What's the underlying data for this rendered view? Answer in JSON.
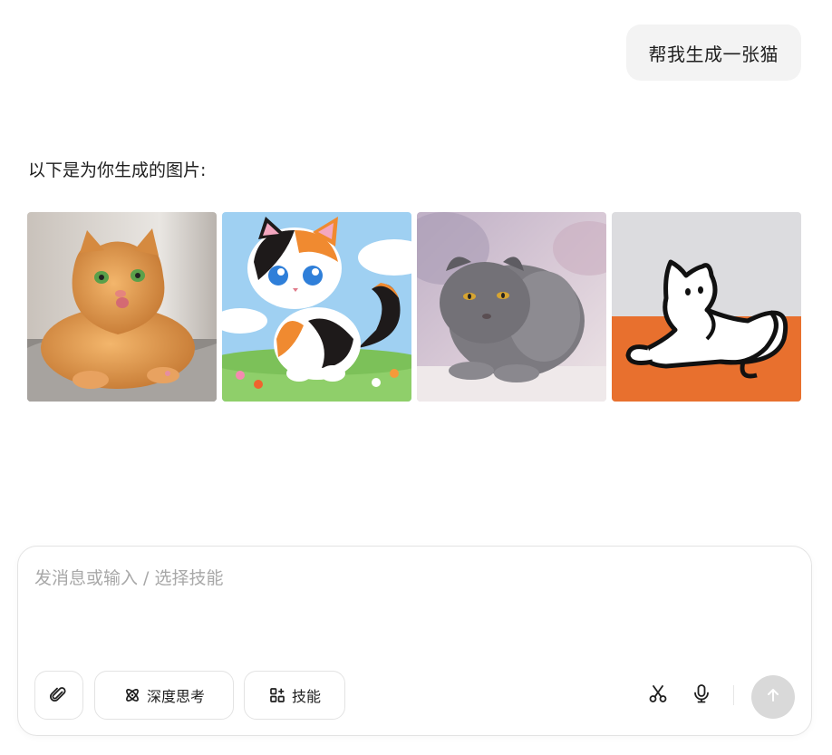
{
  "chat": {
    "user_message": "帮我生成一张猫",
    "reply_text": "以下是为你生成的图片:",
    "images": [
      {
        "icon": "orange-tabby-cat-photo"
      },
      {
        "icon": "calico-kitten-cartoon"
      },
      {
        "icon": "grey-scottish-fold-watercolor"
      },
      {
        "icon": "white-cat-line-drawing"
      }
    ]
  },
  "composer": {
    "placeholder": "发消息或输入 / 选择技能",
    "value": "",
    "deep_think_label": "深度思考",
    "skills_label": "技能",
    "icons": {
      "attach": "paperclip-icon",
      "deep_think": "atom-icon",
      "skills": "grid-icon",
      "scissors": "scissors-icon",
      "mic": "microphone-icon",
      "send": "arrow-up-icon"
    },
    "send_button_color": "#d9d9d9"
  }
}
